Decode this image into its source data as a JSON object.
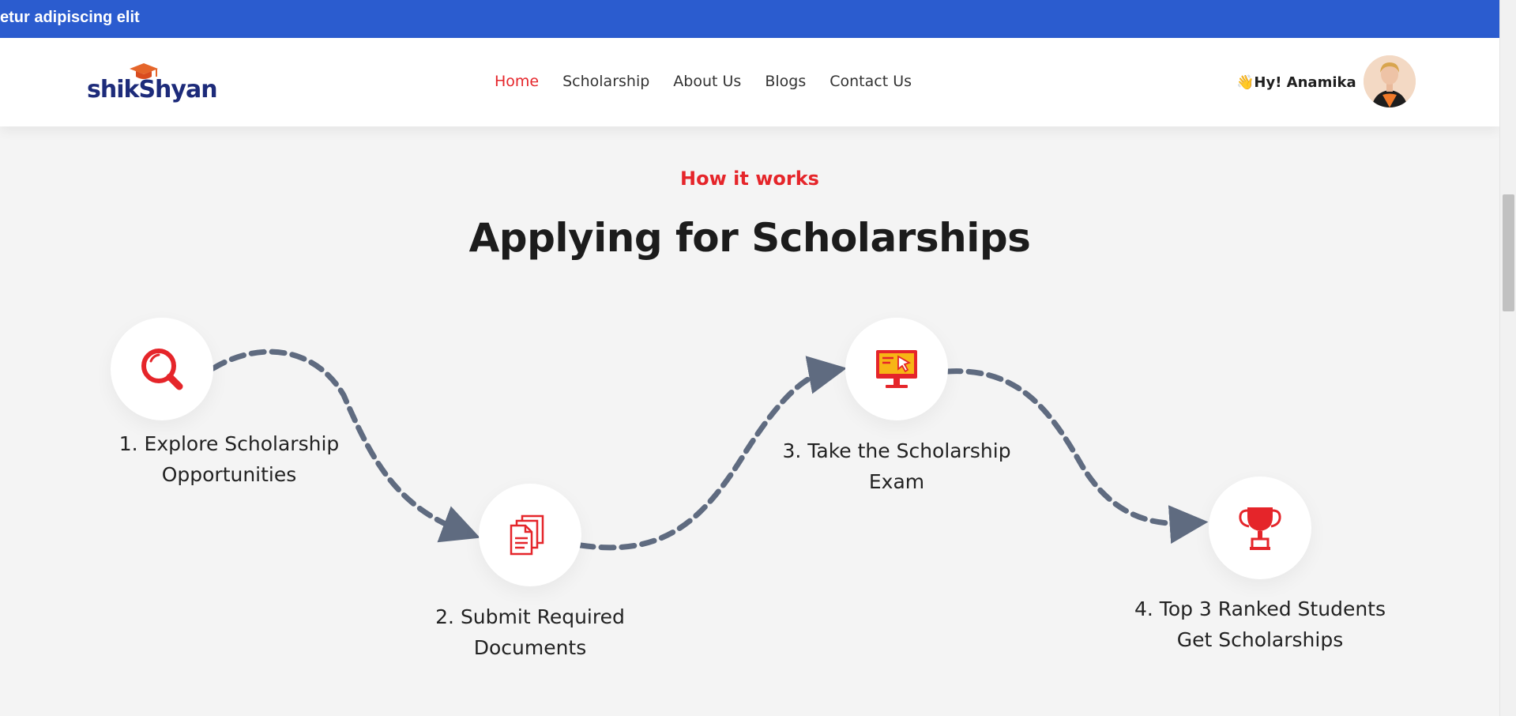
{
  "topbar": {
    "text": "etur adipiscing elit"
  },
  "header": {
    "logo_text": "shikShyan",
    "nav": [
      {
        "label": "Home",
        "active": true
      },
      {
        "label": "Scholarship",
        "active": false
      },
      {
        "label": "About Us",
        "active": false
      },
      {
        "label": "Blogs",
        "active": false
      },
      {
        "label": "Contact Us",
        "active": false
      }
    ],
    "greeting": "👋Hy! Anamika"
  },
  "section": {
    "eyebrow": "How it works",
    "title": "Applying for Scholarships",
    "steps": [
      {
        "label_line1": "1. Explore Scholarship",
        "label_line2": "Opportunities",
        "icon": "search-icon"
      },
      {
        "label_line1": "2. Submit Required",
        "label_line2": "Documents",
        "icon": "documents-icon"
      },
      {
        "label_line1": "3. Take the Scholarship",
        "label_line2": "Exam",
        "icon": "computer-exam-icon"
      },
      {
        "label_line1": "4. Top 3 Ranked Students",
        "label_line2": "Get Scholarships",
        "icon": "trophy-icon"
      }
    ]
  },
  "colors": {
    "accent": "#e5252a",
    "topbar": "#2b5ccf",
    "connector": "#5f6b80",
    "logo": "#1d2b7a"
  }
}
